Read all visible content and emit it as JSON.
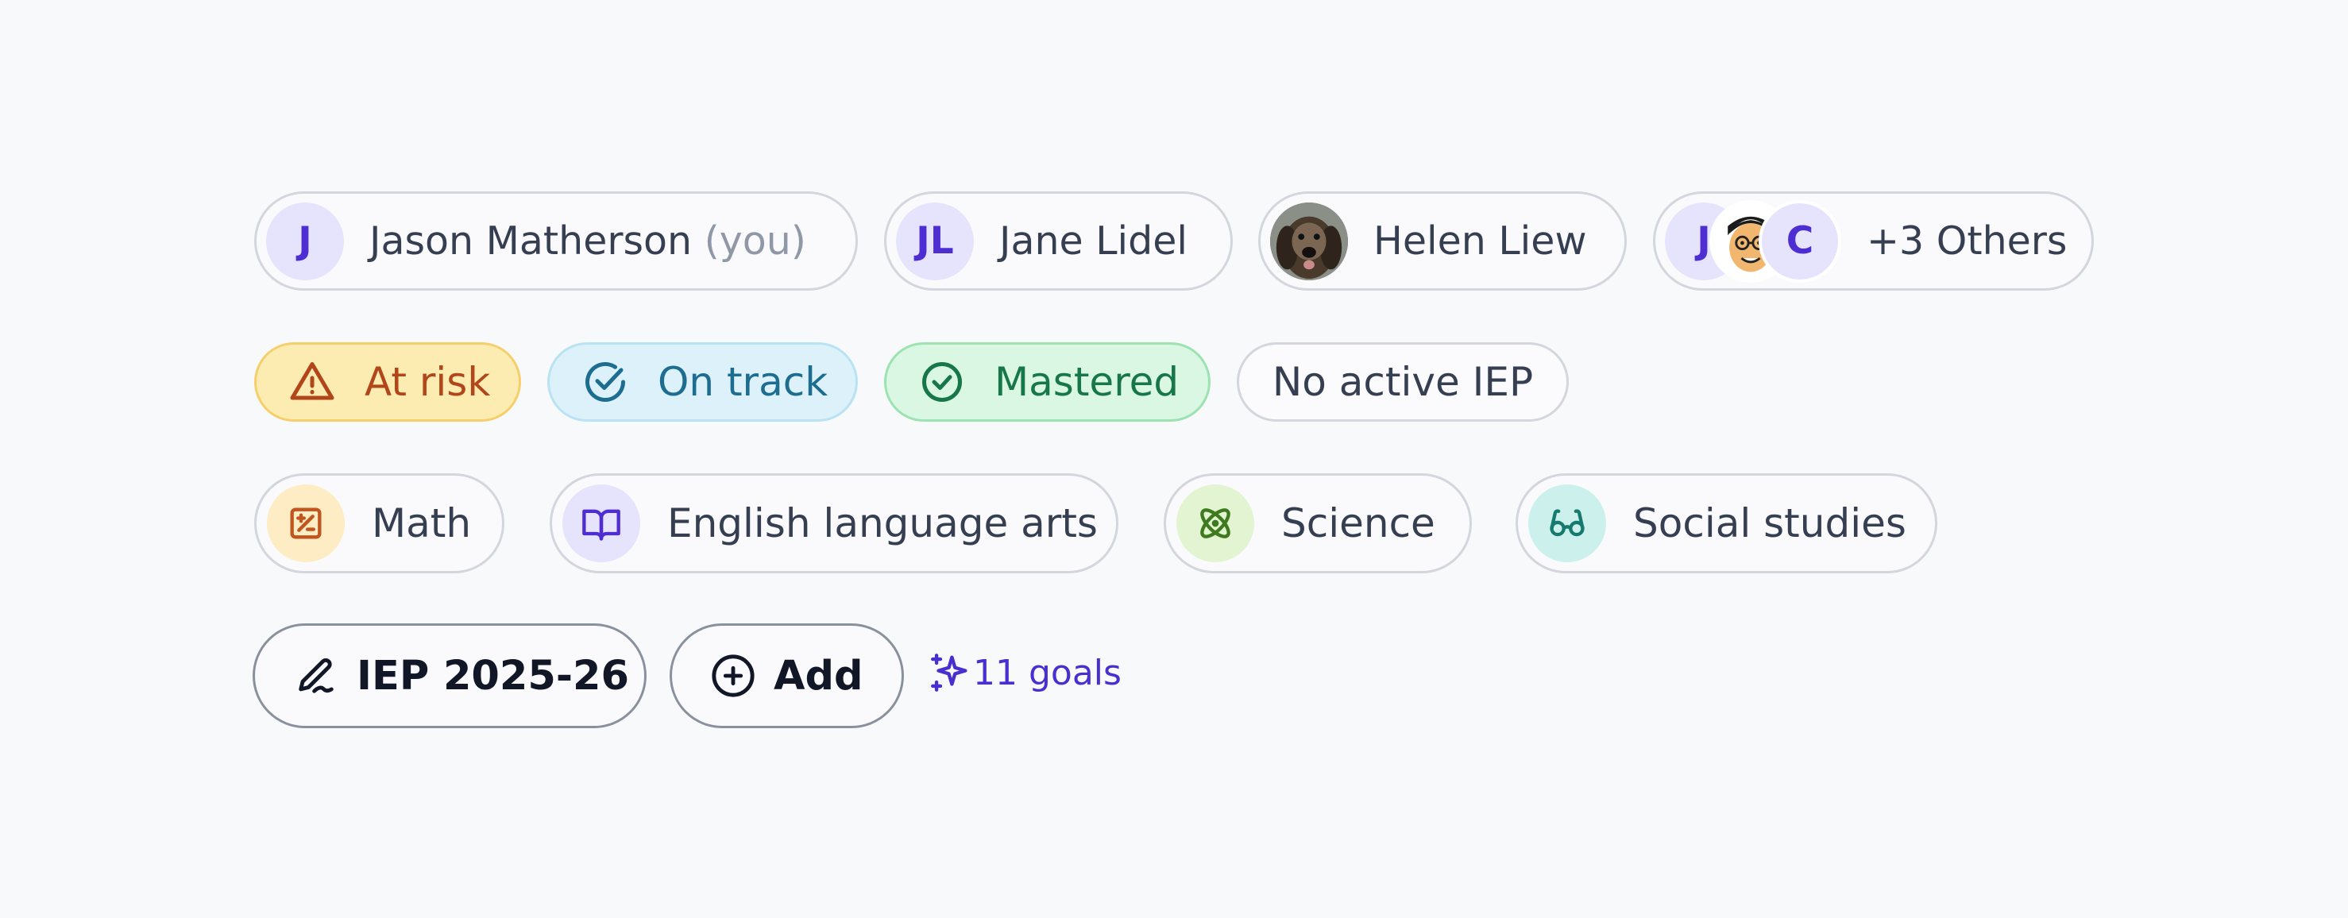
{
  "people": [
    {
      "initials": "J",
      "name": "Jason Matherson",
      "suffix": "(you)"
    },
    {
      "initials": "JL",
      "name": "Jane Lidel"
    },
    {
      "photo": "dog-photo",
      "name": "Helen Liew"
    },
    {
      "avatars": [
        "J",
        "cartoon-face",
        "C"
      ],
      "name": "+3 Others"
    }
  ],
  "statuses": [
    {
      "label": "At risk",
      "icon": "warning-triangle-icon",
      "color": "#b1461a"
    },
    {
      "label": "On track",
      "icon": "check-circle-icon",
      "color": "#1c6d8f"
    },
    {
      "label": "Mastered",
      "icon": "check-circle-icon",
      "color": "#17764a"
    },
    {
      "label": "No active IEP"
    }
  ],
  "subjects": [
    {
      "label": "Math",
      "icon": "calculator-icon",
      "color": "#fdecc4"
    },
    {
      "label": "English language arts",
      "icon": "book-open-icon",
      "color": "#e6e3fd"
    },
    {
      "label": "Science",
      "icon": "atom-icon",
      "color": "#e3f4d2"
    },
    {
      "label": "Social studies",
      "icon": "glasses-icon",
      "color": "#ccf1ec"
    }
  ],
  "actions": {
    "iep_label": "IEP 2025-26",
    "iep_icon": "pen-signature-icon",
    "add_label": "Add",
    "add_icon": "plus-circle-icon",
    "goals_label": "11 goals",
    "goals_icon": "sparkles-icon"
  },
  "accent": "#4e2ed2"
}
